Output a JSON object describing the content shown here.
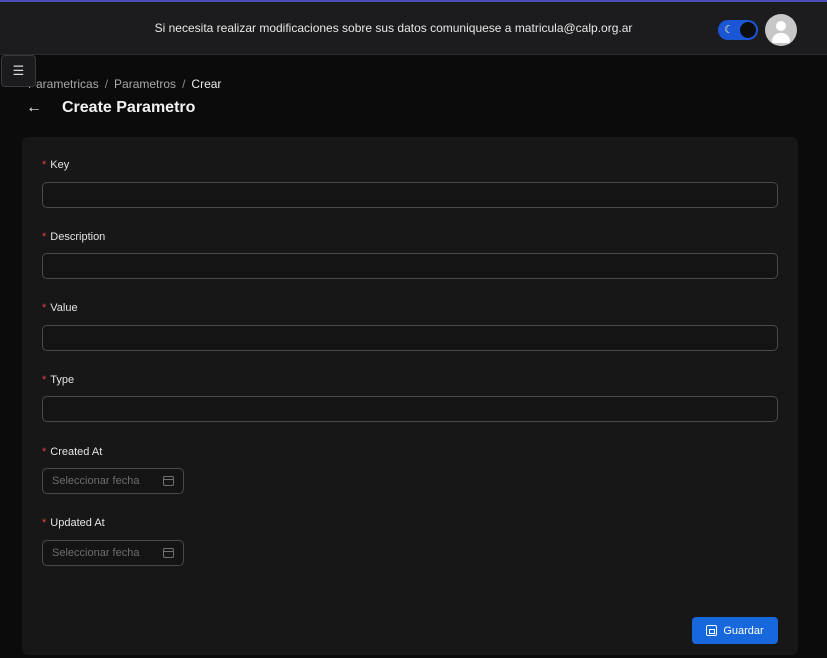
{
  "header": {
    "message": "Si necesita realizar modificaciones sobre sus datos comuniquese a matricula@calp.org.ar",
    "theme_toggle_icon": "moon-icon",
    "avatar_icon": "user-icon"
  },
  "menu_button": {
    "icon": "list-icon",
    "glyph": "☰"
  },
  "breadcrumb": {
    "items": [
      "Parametricas",
      "Parametros",
      "Crear"
    ],
    "separator": "/"
  },
  "page": {
    "back_icon": "←",
    "title": "Create Parametro"
  },
  "form": {
    "required_marker": "*",
    "key": {
      "label": "Key",
      "value": ""
    },
    "description": {
      "label": "Description",
      "value": ""
    },
    "value": {
      "label": "Value",
      "value": ""
    },
    "type": {
      "label": "Type",
      "value": ""
    },
    "created_at": {
      "label": "Created At",
      "placeholder": "Seleccionar fecha"
    },
    "updated_at": {
      "label": "Updated At",
      "placeholder": "Seleccionar fecha"
    },
    "save_label": "Guardar"
  },
  "colors": {
    "accent": "#1668dc",
    "required": "#e0433a",
    "background": "#0b0b0b",
    "card": "#171718"
  }
}
